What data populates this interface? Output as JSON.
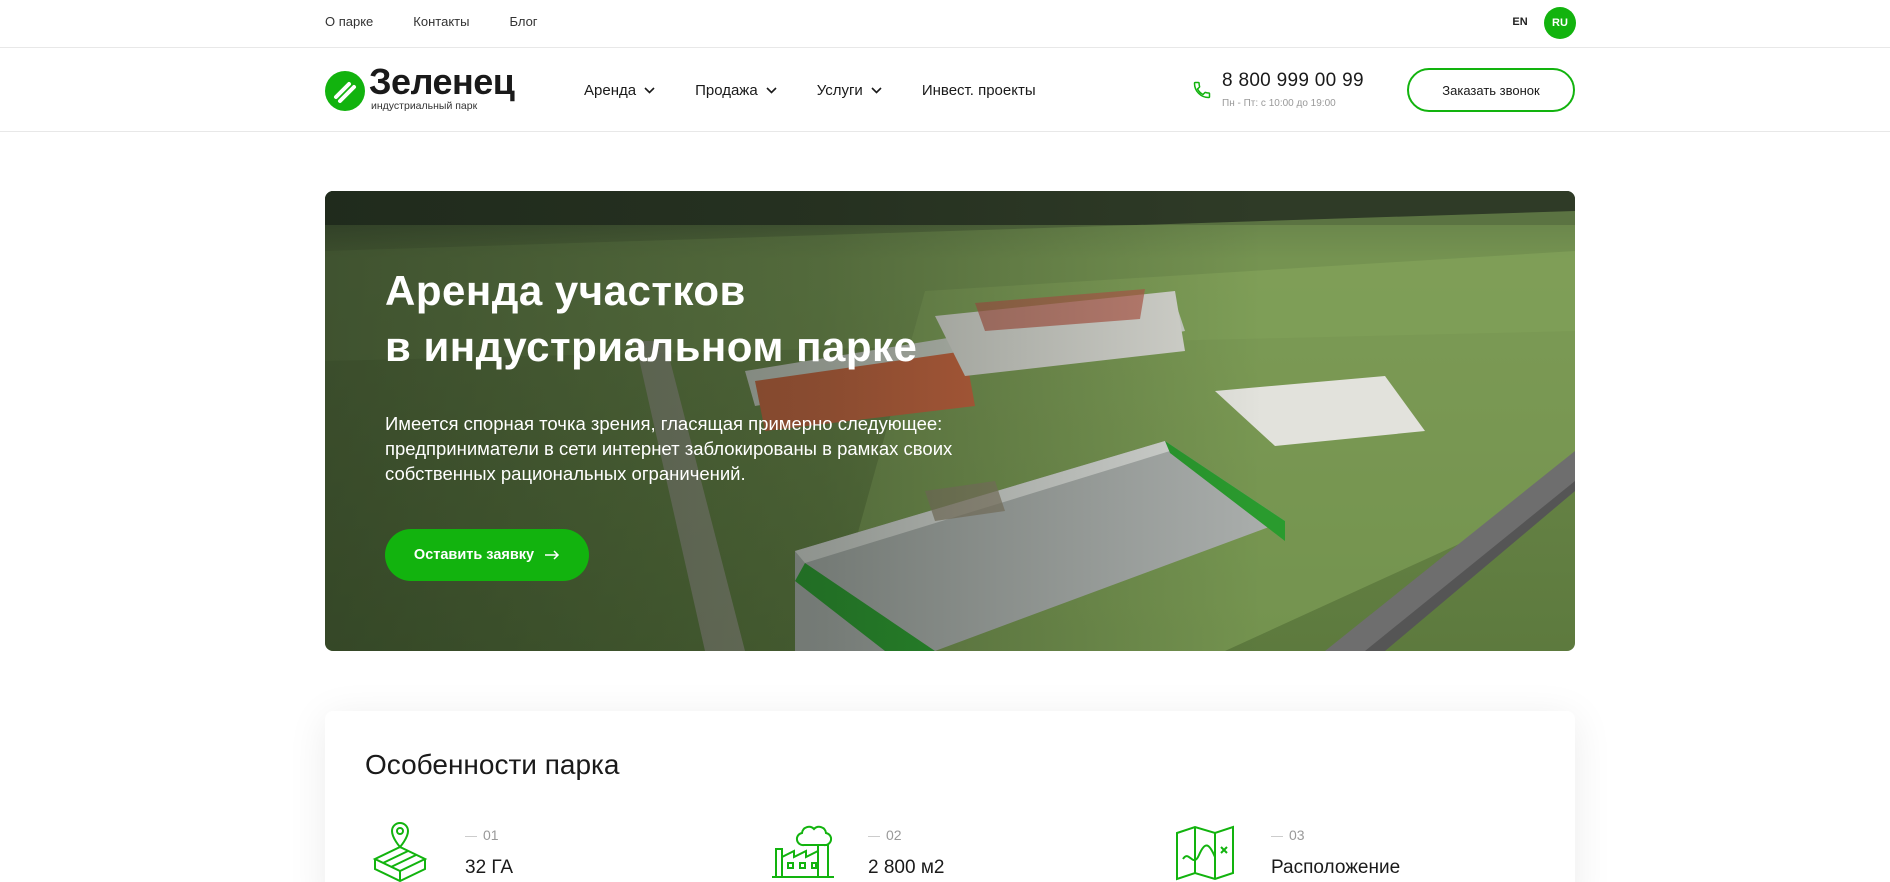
{
  "topbar": {
    "links": [
      "О парке",
      "Контакты",
      "Блог"
    ],
    "lang_en": "EN",
    "lang_ru": "RU"
  },
  "header": {
    "logo_title": "Зеленец",
    "logo_subtitle": "индустриальный парк",
    "nav": [
      {
        "label": "Аренда",
        "icon": "chevron-down-icon"
      },
      {
        "label": "Продажа",
        "icon": "chevron-down-icon"
      },
      {
        "label": "Услуги",
        "icon": "chevron-down-icon"
      },
      {
        "label": "Инвест. проекты"
      }
    ],
    "phone": "8 800 999 00 99",
    "hours": "Пн - Пт: с 10:00 до 19:00",
    "callback_label": "Заказать звонок"
  },
  "hero": {
    "title_line1": "Аренда участков",
    "title_line2": "в индустриальном парке",
    "text": "Имеется спорная точка зрения, гласящая примерно следующее: предприниматели в сети интернет заблокированы в рамках своих собственных рациональных ограничений.",
    "button_label": "Оставить заявку",
    "button_icon": "arrow-right-icon"
  },
  "features": {
    "title": "Особенности парка",
    "items": [
      {
        "num": "01",
        "value": "32 ГА",
        "icon": "land-plot-icon"
      },
      {
        "num": "02",
        "value": "2 800 м2",
        "icon": "factory-icon"
      },
      {
        "num": "03",
        "value": "Расположение",
        "icon": "map-icon"
      }
    ]
  },
  "colors": {
    "accent": "#12b30e",
    "text": "#1a1a1a",
    "muted": "#999999"
  }
}
